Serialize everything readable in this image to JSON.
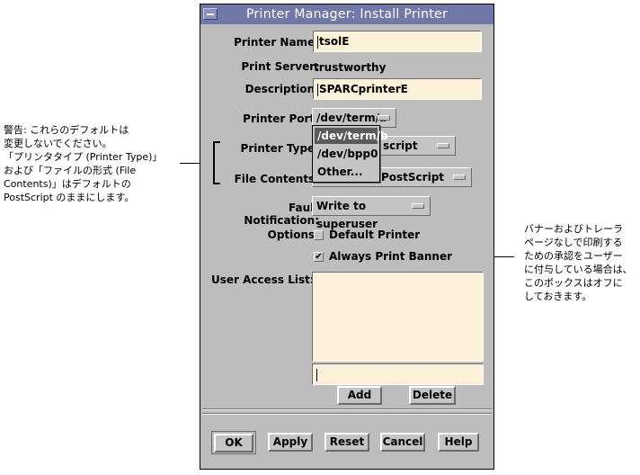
{
  "window": {
    "title": "Printer Manager: Install Printer"
  },
  "form": {
    "printer_name_label": "Printer Name:",
    "printer_name_value": "tsolE",
    "print_server_label": "Print Server:",
    "print_server_value": "trustworthy",
    "description_label": "Description:",
    "description_value": "SPARCprinterE",
    "printer_port_label": "Printer Port:",
    "printer_port_value": "/dev/term/a",
    "port_options": [
      "/dev/term/b",
      "/dev/bpp0",
      "Other..."
    ],
    "printer_type_label": "Printer Type:",
    "printer_type_value": "script",
    "file_contents_label": "File Contents:",
    "file_contents_value": "PostScript",
    "fault_label": "Fault Notification:",
    "fault_value": "Write to superuser",
    "options_label": "Options:",
    "default_printer_label": "Default Printer",
    "always_banner_label": "Always Print Banner",
    "default_printer_checked": false,
    "always_banner_checked": true,
    "user_access_label": "User Access List:",
    "add_label": "Add",
    "delete_label": "Delete"
  },
  "buttons": {
    "ok": "OK",
    "apply": "Apply",
    "reset": "Reset",
    "cancel": "Cancel",
    "help": "Help"
  },
  "annotations": {
    "left": [
      "警告: これらのデフォルトは",
      "変更しないでください。",
      "「プリンタタイプ (Printer Type)」",
      "および「ファイルの形式 (File",
      "Contents)」はデフォルトの",
      "PostScript のままにします。"
    ],
    "right": [
      "バナーおよびトレーラ",
      "ページなしで印刷する",
      "ための承認をユーザー",
      "に付与している場合は、",
      "このボックスはオフに",
      "しておきます。"
    ]
  }
}
